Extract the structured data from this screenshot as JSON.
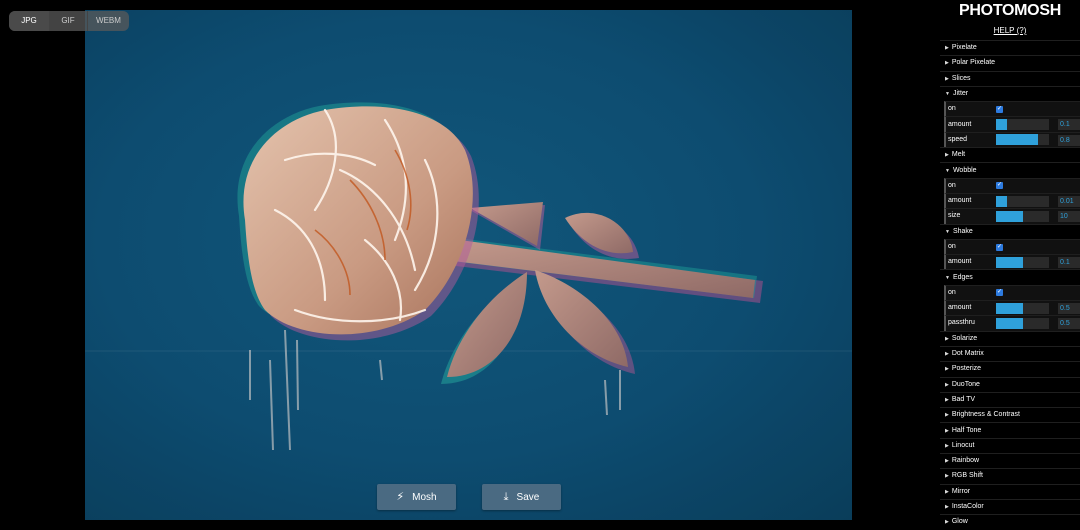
{
  "format_tabs": [
    "JPG",
    "GIF",
    "WEBM"
  ],
  "active_format": "JPG",
  "actions": {
    "mosh_label": "Mosh",
    "save_label": "Save"
  },
  "sidebar": {
    "logo": "PHOTOMOSH",
    "help": "HELP (?)",
    "effects": [
      {
        "label": "Pixelate",
        "expanded": false
      },
      {
        "label": "Polar Pixelate",
        "expanded": false
      },
      {
        "label": "Slices",
        "expanded": false
      },
      {
        "label": "Jitter",
        "expanded": true,
        "controls": [
          {
            "label": "on",
            "type": "checkbox",
            "checked": true
          },
          {
            "label": "amount",
            "type": "slider",
            "level": 0.2,
            "value": "0.1"
          },
          {
            "label": "speed",
            "type": "slider",
            "level": 0.8,
            "value": "0.8"
          }
        ]
      },
      {
        "label": "Melt",
        "expanded": false
      },
      {
        "label": "Wobble",
        "expanded": true,
        "controls": [
          {
            "label": "on",
            "type": "checkbox",
            "checked": true
          },
          {
            "label": "amount",
            "type": "slider",
            "level": 0.2,
            "value": "0.01"
          },
          {
            "label": "size",
            "type": "slider",
            "level": 0.5,
            "value": "10"
          }
        ]
      },
      {
        "label": "Shake",
        "expanded": true,
        "controls": [
          {
            "label": "on",
            "type": "checkbox",
            "checked": true
          },
          {
            "label": "amount",
            "type": "slider",
            "level": 0.5,
            "value": "0.1"
          }
        ]
      },
      {
        "label": "Edges",
        "expanded": true,
        "controls": [
          {
            "label": "on",
            "type": "checkbox",
            "checked": true
          },
          {
            "label": "amount",
            "type": "slider",
            "level": 0.5,
            "value": "0.5"
          },
          {
            "label": "passthru",
            "type": "slider",
            "level": 0.5,
            "value": "0.5"
          }
        ]
      },
      {
        "label": "Solarize",
        "expanded": false
      },
      {
        "label": "Dot Matrix",
        "expanded": false
      },
      {
        "label": "Posterize",
        "expanded": false
      },
      {
        "label": "DuoTone",
        "expanded": false
      },
      {
        "label": "Bad TV",
        "expanded": false
      },
      {
        "label": "Brightness & Contrast",
        "expanded": false
      },
      {
        "label": "Half Tone",
        "expanded": false
      },
      {
        "label": "Linocut",
        "expanded": false
      },
      {
        "label": "Rainbow",
        "expanded": false
      },
      {
        "label": "RGB Shift",
        "expanded": false
      },
      {
        "label": "Mirror",
        "expanded": false
      },
      {
        "label": "InstaColor",
        "expanded": false
      },
      {
        "label": "Glow",
        "expanded": false
      }
    ]
  },
  "colors": {
    "accent": "#2fa1db",
    "canvas_bg": "#0a4a6e",
    "rose": "#d9b6a0"
  }
}
